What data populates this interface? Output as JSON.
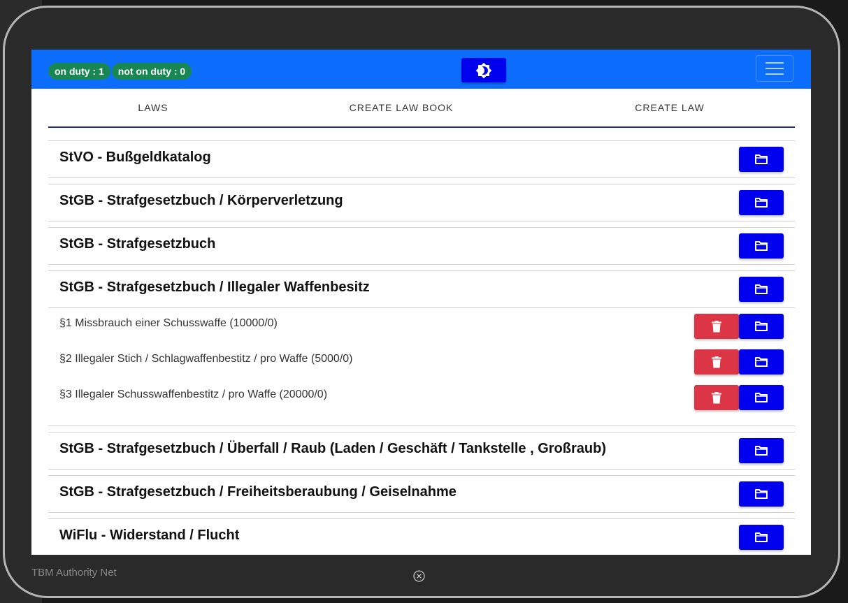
{
  "status": {
    "on_duty": "on duty : 1",
    "not_on_duty": "not on duty : 0"
  },
  "icons": {
    "theme": "brightness-icon",
    "menu": "hamburger-menu-icon",
    "open": "folder-icon",
    "delete": "trash-icon",
    "close": "close-circle-icon"
  },
  "colors": {
    "navbar": "#0d6efd",
    "badge": "#198754",
    "primary_button": "#0000ee",
    "danger_button": "#dc3545"
  },
  "tabs": [
    {
      "label": "LAWS"
    },
    {
      "label": "CREATE LAW BOOK"
    },
    {
      "label": "CREATE LAW"
    }
  ],
  "law_books": [
    {
      "title": "StVO - Bußgeldkatalog",
      "laws": []
    },
    {
      "title": "StGB - Strafgesetzbuch / Körperverletzung",
      "laws": []
    },
    {
      "title": "StGB - Strafgesetzbuch",
      "laws": []
    },
    {
      "title": "StGB - Strafgesetzbuch / Illegaler Waffenbesitz",
      "laws": [
        {
          "label": "§1 Missbrauch einer Schusswaffe (10000/0)"
        },
        {
          "label": "§2 Illegaler Stich / Schlagwaffenbestitz / pro Waffe (5000/0)"
        },
        {
          "label": "§3 Illegaler Schusswaffenbestitz / pro Waffe (20000/0)"
        }
      ]
    },
    {
      "title": "StGB - Strafgesetzbuch / Überfall / Raub (Laden / Geschäft / Tankstelle , Großraub)",
      "laws": []
    },
    {
      "title": "StGB - Strafgesetzbuch / Freiheitsberaubung / Geiselnahme",
      "laws": []
    },
    {
      "title": "WiFlu - Widerstand / Flucht",
      "laws": []
    }
  ],
  "footer": {
    "brand": "TBM Authority Net"
  }
}
